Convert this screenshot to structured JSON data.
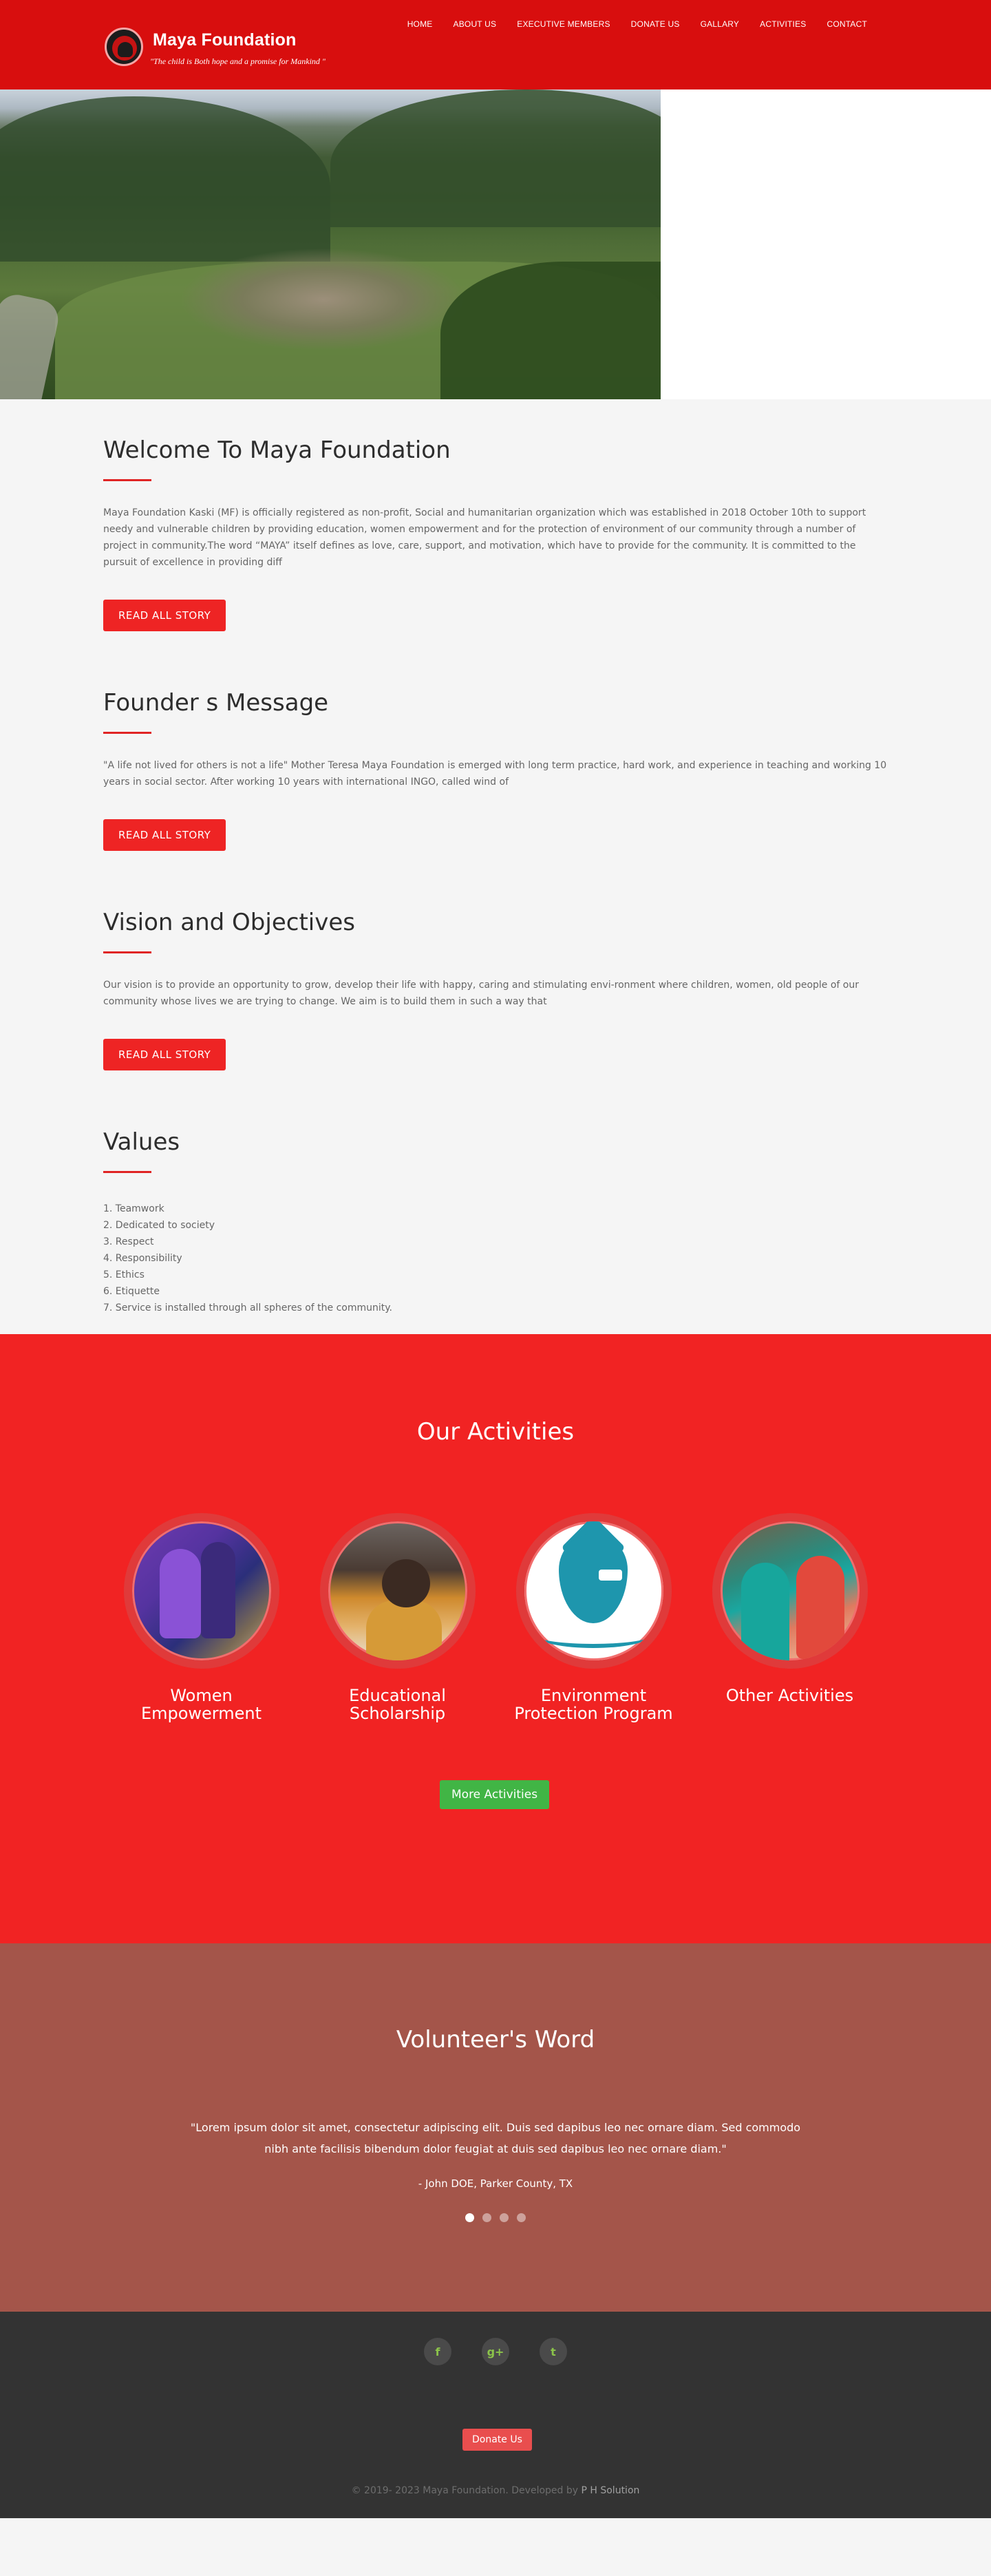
{
  "header": {
    "brand": "Maya Foundation",
    "tagline": "\"The  child is Both hope and a promise for Mankind \"",
    "nav": [
      "HOME",
      "ABOUT US",
      "EXECUTIVE MEMBERS",
      "DONATE US",
      "GALLARY",
      "ACTIVITIES",
      "CONTACT"
    ],
    "accent_color": "#d80e0e"
  },
  "welcome": {
    "title": "Welcome To Maya Foundation",
    "body": "Maya Foundation Kaski (MF) is officially registered as non-profit, Social and humanitarian organization which was established in 2018 October 10th to support needy and vulnerable children by providing education, women empowerment and for the protection of environment of our community through a number of project in community.The word “MAYA” itself defines as love, care, support, and motivation, which have to provide for the community. It is committed to the pursuit of excellence in providing diff",
    "button": "READ ALL STORY"
  },
  "founder": {
    "title": "Founder s Message",
    "body": "\"A life not lived for others is not a life\" Mother Teresa Maya Foundation is emerged with long term practice, hard work, and experience in teaching and working 10 years in social sector. After working 10 years with international INGO, called wind of",
    "button": "READ ALL STORY"
  },
  "vision": {
    "title": "Vision and Objectives",
    "body": "Our vision is to provide an opportunity to grow, develop their life with happy, caring and stimulating envi-ronment where children, women, old people of our community whose lives we are trying to change. We aim is to build them in such a way that",
    "button": "READ ALL STORY"
  },
  "values": {
    "title": "Values",
    "items": [
      "1. Teamwork",
      "2. Dedicated to society",
      "3. Respect",
      "4. Responsibility",
      "5. Ethics",
      "6. Etiquette",
      "7. Service is installed through all spheres of the community."
    ]
  },
  "activities": {
    "title": "Our Activities",
    "items": [
      {
        "line1": "Women",
        "line2": "Empowerment"
      },
      {
        "line1": "Educational",
        "line2": "Scholarship"
      },
      {
        "line1": "Environment",
        "line2": "Protection Program"
      },
      {
        "line1": "Other Activities",
        "line2": ""
      }
    ],
    "button": "More Activities",
    "background_color": "#f12323",
    "button_color": "#41b545"
  },
  "volunteer": {
    "title": "Volunteer's Word",
    "quote": "\"Lorem ipsum dolor sit amet, consectetur adipiscing elit. Duis sed dapibus leo nec ornare diam. Sed commodo nibh ante facilisis bibendum dolor feugiat at duis sed dapibus leo nec ornare diam.\"",
    "author": "- John DOE, Parker County, TX",
    "background_color": "#a4554a"
  },
  "footer": {
    "social": [
      "f",
      "g+",
      "t"
    ],
    "donate_button": "Donate Us",
    "copyright": "© 2019- 2023 Maya Foundation. Developed by",
    "developer": "P H Solution"
  }
}
